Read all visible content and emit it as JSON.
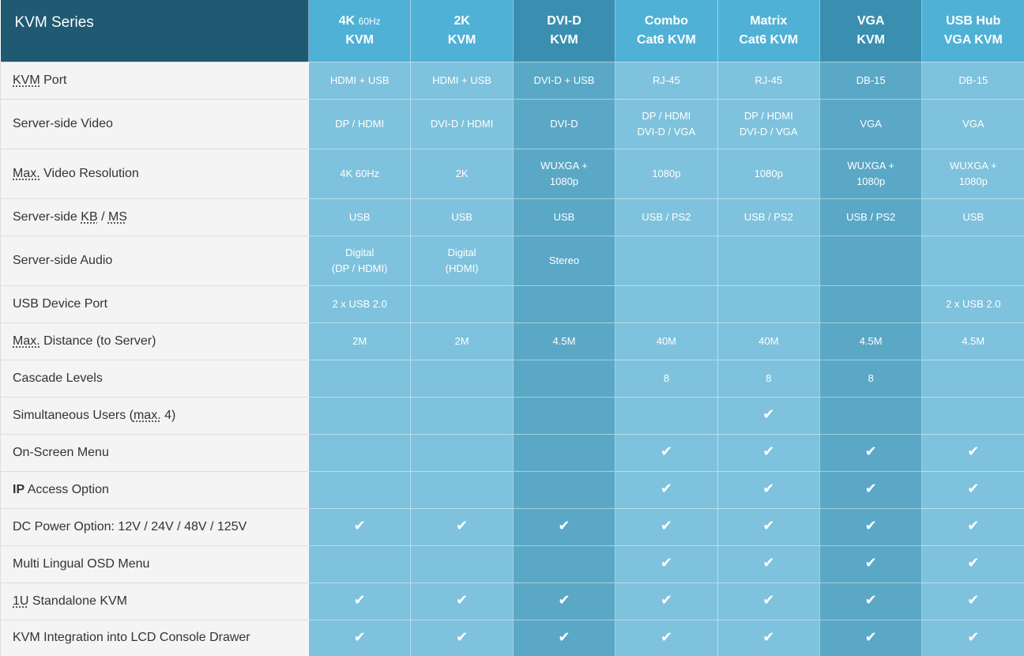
{
  "table": {
    "corner_label": "KVM Series",
    "columns": [
      {
        "line1": "4K",
        "line1_small": "60Hz",
        "line2": "KVM",
        "dark": false
      },
      {
        "line1": "2K",
        "line1_small": "",
        "line2": "KVM",
        "dark": false
      },
      {
        "line1": "DVI-D",
        "line1_small": "",
        "line2": "KVM",
        "dark": true
      },
      {
        "line1": "Combo",
        "line1_small": "",
        "line2": "Cat6 KVM",
        "dark": false
      },
      {
        "line1": "Matrix",
        "line1_small": "",
        "line2": "Cat6 KVM",
        "dark": false
      },
      {
        "line1": "VGA",
        "line1_small": "",
        "line2": "KVM",
        "dark": true
      },
      {
        "line1": "USB Hub",
        "line1_small": "",
        "line2": "VGA KVM",
        "dark": false
      }
    ],
    "check_glyph": "✔",
    "rows": [
      {
        "label": "KVM Port",
        "h": 47,
        "cells": [
          "HDMI + USB",
          "HDMI + USB",
          "DVI-D + USB",
          "RJ-45",
          "RJ-45",
          "DB-15",
          "DB-15"
        ]
      },
      {
        "label": "Server-side Video",
        "h": 63,
        "cells": [
          "DP / HDMI",
          "DVI-D / HDMI",
          "DVI-D",
          "DP / HDMI\nDVI-D / VGA",
          "DP / HDMI\nDVI-D / VGA",
          "VGA",
          "VGA"
        ]
      },
      {
        "label": "Max. Video Resolution",
        "h": 63,
        "cells": [
          "4K 60Hz",
          "2K",
          "WUXGA +\n1080p",
          "1080p",
          "1080p",
          "WUXGA +\n1080p",
          "WUXGA +\n1080p"
        ]
      },
      {
        "label": "Server-side KB / MS",
        "h": 47,
        "cells": [
          "USB",
          "USB",
          "USB",
          "USB / PS2",
          "USB / PS2",
          "USB / PS2",
          "USB"
        ]
      },
      {
        "label": "Server-side Audio",
        "h": 63,
        "cells": [
          "Digital\n(DP / HDMI)",
          "Digital\n(HDMI)",
          "Stereo",
          "",
          "",
          "",
          ""
        ]
      },
      {
        "label": "USB Device Port",
        "h": 47,
        "cells": [
          "2 x USB 2.0",
          "",
          "",
          "",
          "",
          "",
          "2 x USB 2.0"
        ]
      },
      {
        "label": "Max. Distance (to Server)",
        "h": 47,
        "cells": [
          "2M",
          "2M",
          "4.5M",
          "40M",
          "40M",
          "4.5M",
          "4.5M"
        ]
      },
      {
        "label": "Cascade Levels",
        "h": 47,
        "cells": [
          "",
          "",
          "",
          "8",
          "8",
          "8",
          ""
        ]
      },
      {
        "label": "Simultaneous Users (max. 4)",
        "h": 47,
        "cells": [
          "",
          "",
          "",
          "",
          "✔",
          "",
          ""
        ]
      },
      {
        "label": "On-Screen Menu",
        "h": 47,
        "cells": [
          "",
          "",
          "",
          "✔",
          "✔",
          "✔",
          "✔"
        ]
      },
      {
        "label": "IP Access Option",
        "h": 47,
        "cells": [
          "",
          "",
          "",
          "✔",
          "✔",
          "✔",
          "✔"
        ]
      },
      {
        "label": "DC Power Option: 12V / 24V / 48V / 125V",
        "h": 47,
        "cells": [
          "✔",
          "✔",
          "✔",
          "✔",
          "✔",
          "✔",
          "✔"
        ]
      },
      {
        "label": "Multi Lingual OSD Menu",
        "h": 47,
        "cells": [
          "",
          "",
          "",
          "✔",
          "✔",
          "✔",
          "✔"
        ]
      },
      {
        "label": "1U Standalone KVM",
        "h": 47,
        "cells": [
          "✔",
          "✔",
          "✔",
          "✔",
          "✔",
          "✔",
          "✔"
        ]
      },
      {
        "label": "KVM Integration into LCD Console Drawer",
        "h": 46,
        "cells": [
          "✔",
          "✔",
          "✔",
          "✔",
          "✔",
          "✔",
          "✔"
        ]
      }
    ]
  },
  "colors": {
    "corner_bg": "#1f5a72",
    "header_light": "#4fb1d6",
    "header_dark": "#3a8fb0",
    "cell_light": "#7fc2dd",
    "cell_dark": "#5aa8c5",
    "label_bg": "#f4f4f4",
    "label_text": "#333333"
  }
}
